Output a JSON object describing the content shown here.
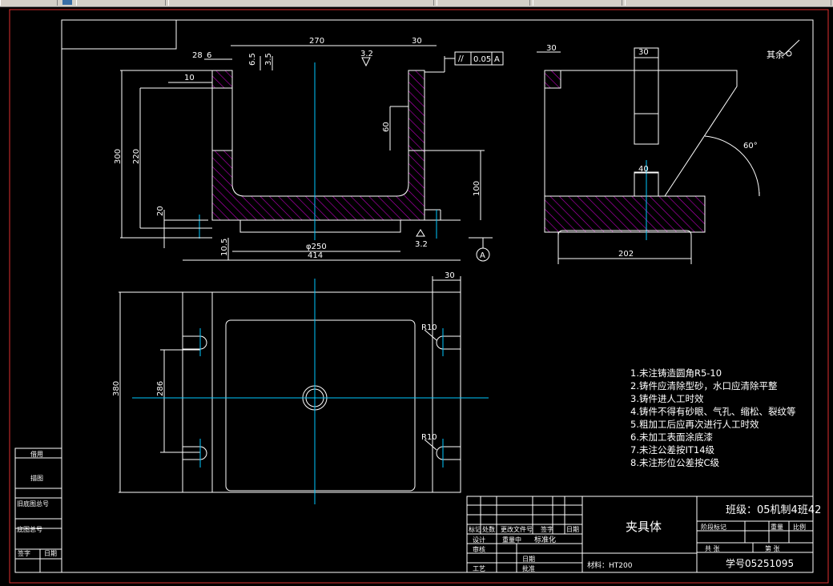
{
  "window": {
    "toolbar_icon": "toolbar-app-icon"
  },
  "colors": {
    "background": "#000000",
    "lines": "#ffffff",
    "hatch": "#c000c0",
    "centerline": "#00c8ff",
    "border": "#e03030"
  },
  "front_view": {
    "dims": {
      "top_width": "270",
      "top_right": "30",
      "left_28": "28",
      "left_6": "6",
      "h_6_5": "6.5",
      "h_3_5": "3.5",
      "w_10": "10",
      "h_300": "300",
      "h_220": "220",
      "h_20": "20",
      "h_60": "60",
      "h_100": "100",
      "h_10_5": "10.5",
      "bottom_phi": "φ250",
      "bottom_width": "414",
      "rough_top": "3.2",
      "rough_bottom": "3.2",
      "tol_value": "0.05",
      "tol_ref": "A",
      "datum": "A"
    }
  },
  "side_view": {
    "dims": {
      "left_30": "30",
      "top_dim": "30",
      "mid_dim": "40",
      "angle": "60°",
      "bottom": "202"
    },
    "rest_label": "其余"
  },
  "plan_view": {
    "dims": {
      "right_30": "30",
      "r10_top": "R10",
      "r10_bottom": "R10",
      "left_h": "286",
      "outer_h": "380"
    }
  },
  "notes": [
    "1.未注铸造圆角R5-10",
    "2.铸件应清除型砂，水口应清除平整",
    "3.铸件进人工时效",
    "4.铸件不得有砂眼、气孔、缩松、裂纹等",
    "5.粗加工后应再次进行人工时效",
    "6.未加工表面涂底漆",
    "7.未注公差按IT14级",
    "8.未注形位公差按C级"
  ],
  "left_table": [
    "借用",
    "描图",
    "旧底图总号",
    "底图总号",
    "签字",
    "日期"
  ],
  "title_block": {
    "part_name": "夹具体",
    "class_label": "班级：05机制4班42",
    "student_no": "学号05251095",
    "material": "材料：HT200",
    "standardization": "标准化",
    "header_cells": [
      "标记",
      "处数",
      "更改文件号",
      "签字",
      "日期"
    ],
    "role_cells": [
      "设计",
      "审核",
      "工艺"
    ],
    "approve_cells": [
      "重量中",
      "批准",
      "日期"
    ],
    "right_header": [
      "阶段标记",
      "重量",
      "比例"
    ],
    "sheet_cells": [
      "共 张",
      "第 张"
    ]
  }
}
